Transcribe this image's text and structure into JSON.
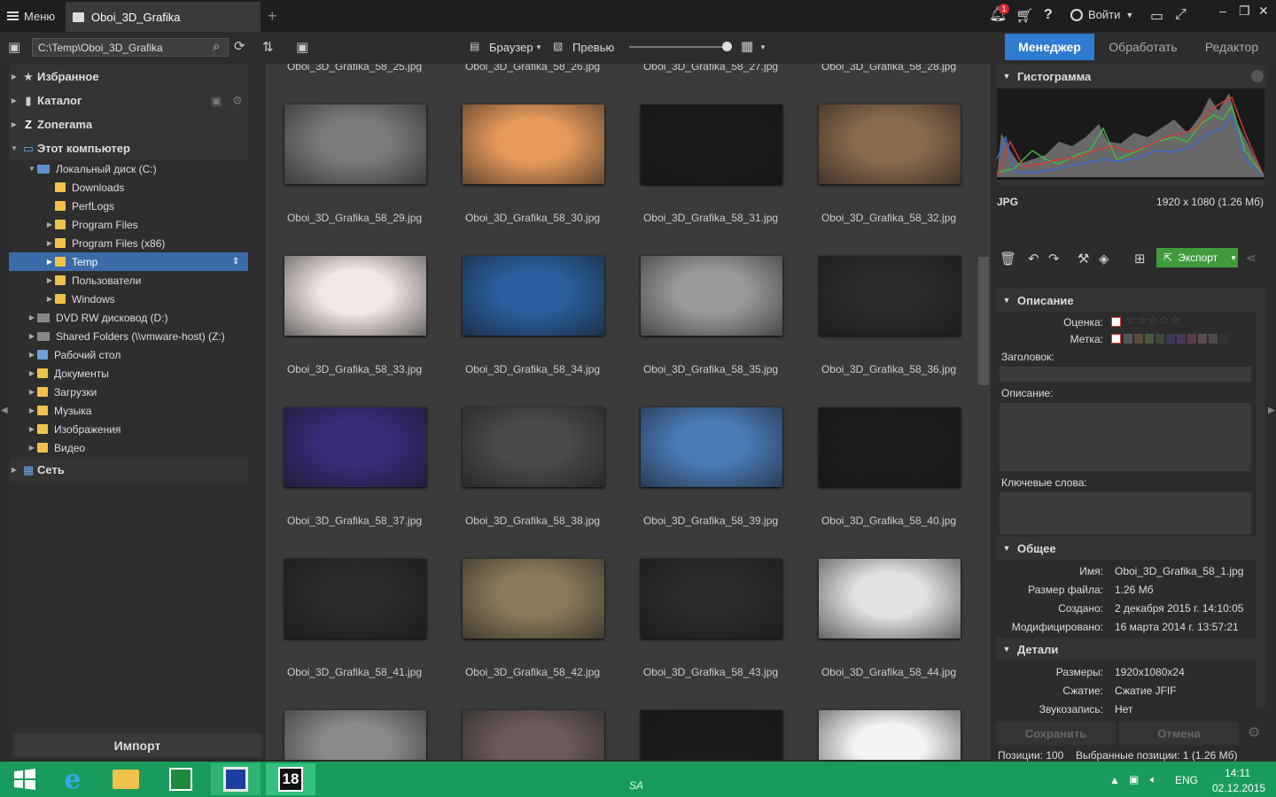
{
  "titlebar": {
    "menu_label": "Меню",
    "tab_title": "Oboi_3D_Grafika",
    "tab_add": "+",
    "notif_count": "1",
    "help": "?",
    "login_label": "Войти",
    "win_min": "–",
    "win_restore": "❐",
    "win_close": "✕"
  },
  "toolbar": {
    "path": "C:\\Temp\\Oboi_3D_Grafika",
    "browser_label": "Браузер",
    "preview_label": "Превью",
    "modes": [
      "Менеджер",
      "Обработать",
      "Редактор"
    ]
  },
  "sidebar": {
    "favorites": "Избранное",
    "catalog": "Каталог",
    "zonerama": "Zonerama",
    "this_pc": "Этот компьютер",
    "local_disk": "Локальный диск (C:)",
    "folders_c": [
      "Downloads",
      "PerfLogs",
      "Program Files",
      "Program Files (x86)",
      "Temp",
      "Пользователи",
      "Windows"
    ],
    "others": [
      "DVD RW дисковод (D:)",
      "Shared Folders (\\\\vmware-host) (Z:)",
      "Рабочий стол",
      "Документы",
      "Загрузки",
      "Музыка",
      "Изображения",
      "Видео"
    ],
    "network": "Сеть",
    "import_label": "Импорт"
  },
  "grid": {
    "top_captions": [
      "Oboi_3D_Grafika_58_25.jpg",
      "Oboi_3D_Grafika_58_26.jpg",
      "Oboi_3D_Grafika_58_27.jpg",
      "Oboi_3D_Grafika_58_28.jpg"
    ],
    "rows": [
      [
        "Oboi_3D_Grafika_58_29.jpg",
        "Oboi_3D_Grafika_58_30.jpg",
        "Oboi_3D_Grafika_58_31.jpg",
        "Oboi_3D_Grafika_58_32.jpg"
      ],
      [
        "Oboi_3D_Grafika_58_33.jpg",
        "Oboi_3D_Grafika_58_34.jpg",
        "Oboi_3D_Grafika_58_35.jpg",
        "Oboi_3D_Grafika_58_36.jpg"
      ],
      [
        "Oboi_3D_Grafika_58_37.jpg",
        "Oboi_3D_Grafika_58_38.jpg",
        "Oboi_3D_Grafika_58_39.jpg",
        "Oboi_3D_Grafika_58_40.jpg"
      ],
      [
        "Oboi_3D_Grafika_58_41.jpg",
        "Oboi_3D_Grafika_58_42.jpg",
        "Oboi_3D_Grafika_58_43.jpg",
        "Oboi_3D_Grafika_58_44.jpg"
      ]
    ],
    "thumb_colors": [
      [
        "#7a7a78",
        "#e79a5c",
        "#1a1a1a",
        "#8a6a4c"
      ],
      [
        "#f2e8e6",
        "#2a5e9e",
        "#9a9a9a",
        "#2a2a2a"
      ],
      [
        "#3a2a7a",
        "#4a4a4a",
        "#4a7ab8",
        "#1c1c1c"
      ],
      [
        "#2a2a2a",
        "#8a7a5a",
        "#2a2a2a",
        "#e2e2e2"
      ],
      [
        "#8a8a8a",
        "#6a5a5a",
        "#1a1a1a",
        "#f4f4f4"
      ]
    ]
  },
  "right": {
    "histogram_title": "Гистограмма",
    "format": "JPG",
    "dimensions": "1920 x 1080 (1.26 Мб)",
    "export_label": "Экспорт",
    "description_title": "Описание",
    "rating_label": "Оценка:",
    "tag_label": "Метка:",
    "heading_label": "Заголовок:",
    "desc_label": "Описание:",
    "keywords_label": "Ключевые слова:",
    "general_title": "Общее",
    "name_label": "Имя:",
    "name_value": "Oboi_3D_Grafika_58_1.jpg",
    "size_label": "Размер файла:",
    "size_value": "1.26 Мб",
    "created_label": "Создано:",
    "created_value": "2 декабря 2015 г. 14:10:05",
    "modified_label": "Модифицировано:",
    "modified_value": "16 марта 2014 г. 13:57:21",
    "details_title": "Детали",
    "dims_label": "Размеры:",
    "dims_value": "1920x1080x24",
    "compress_label": "Сжатие:",
    "compress_value": "Сжатие JFIF",
    "audio_label": "Звукозапись:",
    "audio_value": "Нет",
    "save_label": "Сохранить",
    "cancel_label": "Отмена",
    "status_positions": "Позиции: 100",
    "status_selected": "Выбранные позиции: 1 (1.26 Мб)",
    "tag_colors": [
      "#555",
      "#5a4a3a",
      "#4a5a3a",
      "#3a4a3a",
      "#3a3a5a",
      "#4a3a5a",
      "#5a3a4a",
      "#5a4a4a",
      "#4a4a4a",
      "#333"
    ]
  },
  "taskbar": {
    "lang": "ENG",
    "time": "14:11",
    "date": "02.12.2015",
    "center_mark": "SA",
    "zps_label": "18"
  }
}
